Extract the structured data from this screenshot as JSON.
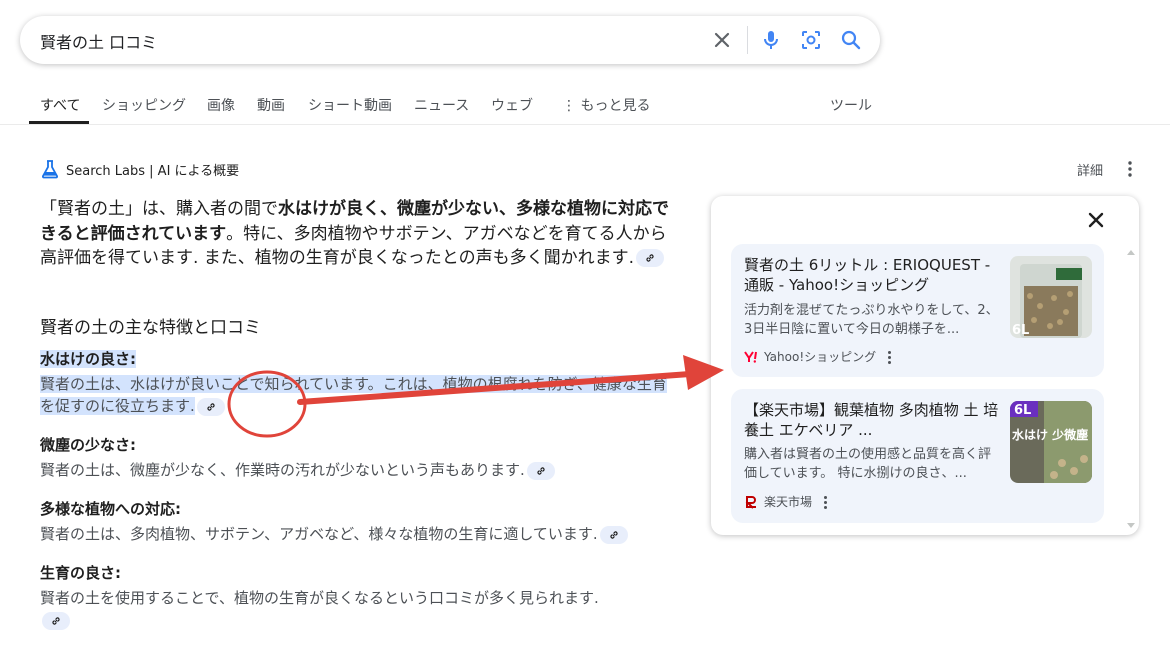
{
  "search": {
    "query": "賢者の土 口コミ"
  },
  "tabs": [
    {
      "label": "すべて"
    },
    {
      "label": "ショッピング"
    },
    {
      "label": "画像"
    },
    {
      "label": "動画"
    },
    {
      "label": "ショート動画"
    },
    {
      "label": "ニュース"
    },
    {
      "label": "ウェブ"
    },
    {
      "label": "もっと見る"
    },
    {
      "label": "ツール"
    }
  ],
  "ai_overview": {
    "title": "Search Labs | AI による概要",
    "detail_label": "詳細",
    "intro_1": "「賢者の土」は、購入者の間で",
    "intro_bold_1": "水はけが良く、微塵が少ない、多様な植物に対応できると評価されています",
    "intro_2": "。特に、多肉植物やサボテン、アガベなどを育てる人から高評価を得ています. また、植物の生育が良くなったとの声も多く聞かれます.",
    "heading": "賢者の土の主な特徴と口コミ",
    "items": [
      {
        "label": "水はけの良さ:",
        "text": "賢者の土は、水はけが良いことで知られています。これは、植物の根腐れを防ぎ、健康な生育を促すのに役立ちます."
      },
      {
        "label": "微塵の少なさ:",
        "text": "賢者の土は、微塵が少なく、作業時の汚れが少ないという声もあります."
      },
      {
        "label": "多様な植物への対応:",
        "text": "賢者の土は、多肉植物、サボテン、アガベなど、様々な植物の生育に適しています."
      },
      {
        "label": "生育の良さ:",
        "text": "賢者の土を使用することで、植物の生育が良くなるという口コミが多く見られます."
      }
    ]
  },
  "sources": [
    {
      "title": "賢者の土 6リットル : ERIOQUEST - 通販 - Yahoo!ショッピング",
      "snippet": "活力剤を混ぜてたっぷり水やりをして、2、3日半日陰に置いて今日の朝様子を...",
      "site": "Yahoo!ショッピング",
      "thumb_label": "6L"
    },
    {
      "title": "【楽天市場】観葉植物 多肉植物 土 培養土 エケベリア ...",
      "snippet": "購入者は賢者の土の使用感と品質を高く評価しています。 特に水捌けの良さ、...",
      "site": "楽天市場",
      "thumb_label": "6L",
      "thumb_text": "水はけ 少微塵 粒状土"
    }
  ],
  "colors": {
    "accent": "#1a73e8",
    "highlight": "#d3e3fd",
    "annotation": "#e0443a"
  }
}
